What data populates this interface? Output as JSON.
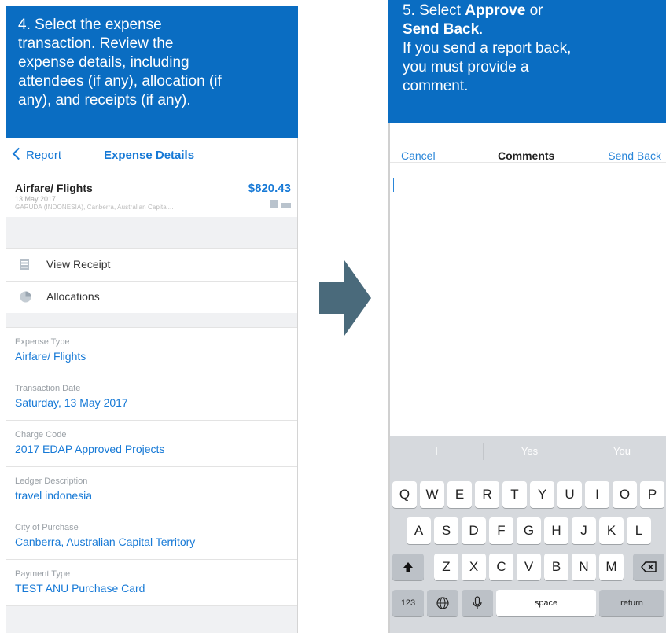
{
  "step4": {
    "lines": [
      "4. Select the expense",
      "transaction. Review the",
      "expense  details, including",
      "attendees  (if any), allocation (if",
      "any), and receipts (if any)."
    ]
  },
  "step5": {
    "line1_prefix": "5. Select ",
    "line1_bold": "Approve",
    "line1_suffix": " or",
    "line2_bold": "Send Back",
    "line2_suffix": ".",
    "line3": "If you send a report back,",
    "line4": "you must provide a",
    "line5": "comment."
  },
  "left_phone": {
    "nav": {
      "back_label": "Report",
      "title": "Expense Details"
    },
    "expense": {
      "name": "Airfare/ Flights",
      "amount": "$820.43",
      "date": "13 May 2017",
      "merchant": "GARUDA (INDONESIA), Canberra, Australian Capital..."
    },
    "actions": [
      {
        "label": "View Receipt",
        "icon": "receipt-icon"
      },
      {
        "label": "Allocations",
        "icon": "pie-chart-icon"
      }
    ],
    "fields": [
      {
        "label": "Expense Type",
        "value": "Airfare/ Flights"
      },
      {
        "label": "Transaction Date",
        "value": "Saturday, 13 May 2017"
      },
      {
        "label": "Charge Code",
        "value": "2017 EDAP Approved Projects"
      },
      {
        "label": "Ledger Description",
        "value": "travel indonesia"
      },
      {
        "label": "City of Purchase",
        "value": "Canberra, Australian Capital Territory"
      },
      {
        "label": "Payment Type",
        "value": "TEST ANU Purchase Card"
      }
    ]
  },
  "right_phone": {
    "nav": {
      "cancel": "Cancel",
      "title": "Comments",
      "send_back": "Send Back"
    },
    "keyboard": {
      "suggestions": [
        "I",
        "Yes",
        "You"
      ],
      "row1": [
        "Q",
        "W",
        "E",
        "R",
        "T",
        "Y",
        "U",
        "I",
        "O",
        "P"
      ],
      "row2": [
        "A",
        "S",
        "D",
        "F",
        "G",
        "H",
        "J",
        "K",
        "L"
      ],
      "row3": [
        "Z",
        "X",
        "C",
        "V",
        "B",
        "N",
        "M"
      ],
      "numbers_key": "123",
      "space_key": "space",
      "return_key": "return"
    }
  },
  "colors": {
    "callout": "#0a6dc2",
    "link": "#1679d6",
    "arrow": "#4a6a7b",
    "keyboard": "#d6d9dd"
  }
}
